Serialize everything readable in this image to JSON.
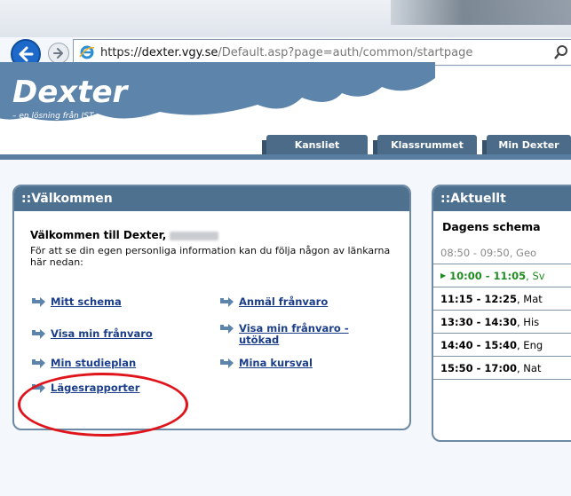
{
  "browser": {
    "url_proto": "https://",
    "url_host": "dexter.vgy.se",
    "url_path": "/Default.asp?page=auth/common/startpage",
    "back_icon": "back-arrow-icon",
    "forward_icon": "forward-arrow-icon",
    "search_icon": "search-icon"
  },
  "site": {
    "logo": "Dexter",
    "tagline": "– en lösning från IST"
  },
  "tabs": [
    {
      "label": "Kansliet"
    },
    {
      "label": "Klassrummet"
    },
    {
      "label": "Min Dexter"
    }
  ],
  "welcome": {
    "heading": "::Välkommen",
    "greeting": "Välkommen till Dexter,",
    "intro": "För att se din egen personliga information kan du följa någon av länkarna här nedan:",
    "links": [
      {
        "label": "Mitt schema"
      },
      {
        "label": "Visa min frånvaro"
      },
      {
        "label": "Min studieplan"
      },
      {
        "label": "Lägesrapporter"
      },
      {
        "label": "Anmäl frånvaro"
      },
      {
        "label": "Visa min frånvaro - utökad"
      },
      {
        "label": "Mina kursval"
      }
    ]
  },
  "current": {
    "heading": "::Aktuellt",
    "schedule_title": "Dagens schema",
    "rows": [
      {
        "time": "08:50 - 09:50",
        "subject": ", Geo"
      },
      {
        "time": "10:00 - 11:05",
        "subject": ", Sv"
      },
      {
        "time": "11:15 - 12:25",
        "subject": ", Mat"
      },
      {
        "time": "13:30 - 14:30",
        "subject": ", His"
      },
      {
        "time": "14:40 - 15:40",
        "subject": ", Eng"
      },
      {
        "time": "15:50 - 17:00",
        "subject": ", Nat"
      }
    ]
  },
  "colors": {
    "header_blue": "#4f7190",
    "link_blue": "#1b3e8a",
    "highlight_red": "#e0141b",
    "current_green": "#1f8c1f"
  }
}
